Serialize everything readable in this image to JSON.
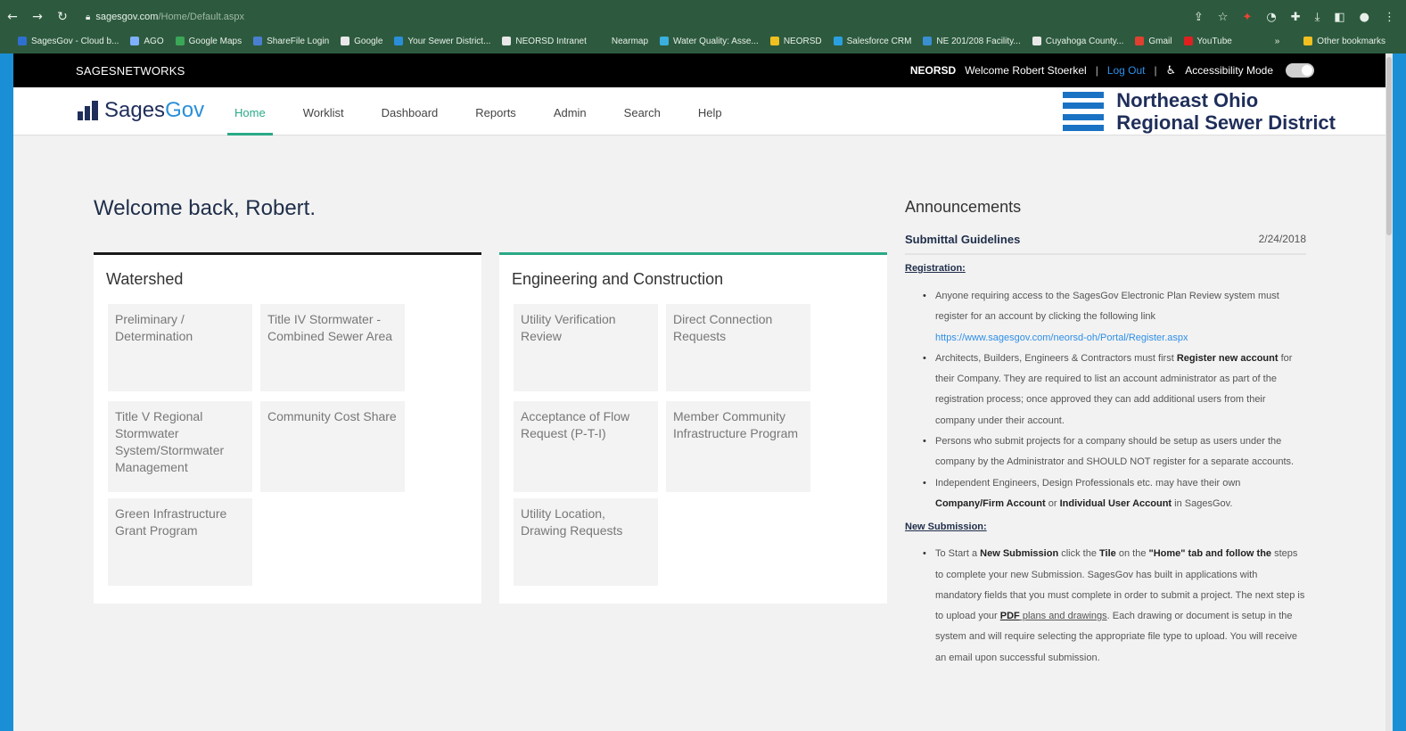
{
  "browser": {
    "url_host": "sagesgov.com",
    "url_path": "/Home/Default.aspx",
    "bookmarks": [
      {
        "label": "SagesGov - Cloud b...",
        "color": "#2f6fd0"
      },
      {
        "label": "AGO",
        "color": "#7fb0ff"
      },
      {
        "label": "Google Maps",
        "color": "#3aa757"
      },
      {
        "label": "ShareFile Login",
        "color": "#4a7fd0"
      },
      {
        "label": "Google",
        "color": "#e8e8e8"
      },
      {
        "label": "Your Sewer District...",
        "color": "#2a8fd8"
      },
      {
        "label": "NEORSD Intranet",
        "color": "#e8e8e8"
      },
      {
        "label": "Nearmap",
        "color": "#2d5a3e"
      },
      {
        "label": "Water Quality: Asse...",
        "color": "#3ab0e0"
      },
      {
        "label": "NEORSD",
        "color": "#f0c020"
      },
      {
        "label": "Salesforce CRM",
        "color": "#2aa0e0"
      },
      {
        "label": "NE 201/208 Facility...",
        "color": "#3a8fd0"
      },
      {
        "label": "Cuyahoga County...",
        "color": "#e8e8e8"
      },
      {
        "label": "Gmail",
        "color": "#e04030"
      },
      {
        "label": "YouTube",
        "color": "#e02020"
      }
    ],
    "other_bookmarks": "Other bookmarks",
    "more": "»"
  },
  "topbar": {
    "brand": "SAGESNETWORKS",
    "org": "NEORSD",
    "welcome": "Welcome Robert Stoerkel",
    "separator": "|",
    "logout": "Log Out",
    "accessibility": "Accessibility Mode"
  },
  "header": {
    "logo_main": "Sages",
    "logo_accent": "Gov",
    "nav": [
      "Home",
      "Worklist",
      "Dashboard",
      "Reports",
      "Admin",
      "Search",
      "Help"
    ],
    "district_line1": "Northeast Ohio",
    "district_line2": "Regional Sewer District"
  },
  "welcome": "Welcome back, Robert.",
  "watershed": {
    "title": "Watershed",
    "tiles": [
      "Preliminary / Determination",
      "Title IV Stormwater - Combined Sewer Area",
      "Title V Regional Stormwater System/Stormwater Management",
      "Community Cost Share",
      "Green Infrastructure Grant Program"
    ]
  },
  "engineering": {
    "title": "Engineering and Construction",
    "tiles": [
      "Utility Verification Review",
      "Direct Connection Requests",
      "Acceptance of Flow Request (P-T-I)",
      "Member Community Infrastructure Program",
      "Utility Location, Drawing Requests"
    ]
  },
  "announcements": {
    "title": "Announcements",
    "item_title": "Submittal Guidelines",
    "item_date": "2/24/2018",
    "registration_head": "Registration:",
    "reg1_a": "Anyone requiring access to the SagesGov Electronic Plan Review system must register for an account by clicking the following link ",
    "reg1_link": "https://www.sagesgov.com/neorsd-oh/Portal/Register.aspx",
    "reg2_a": "Architects, Builders, Engineers & Contractors must first ",
    "reg2_b": "Register new account",
    "reg2_c": " for their Company. They are required to list an account administrator as part of the registration process; once approved they can add additional users from their company under their account.",
    "reg3": "Persons who submit projects for a company should be setup as users under the company by the Administrator and SHOULD NOT register for a separate accounts.",
    "reg4_a": "Independent Engineers, Design Professionals etc. may have their own ",
    "reg4_b": "Company/Firm Account",
    "reg4_c": " or ",
    "reg4_d": "Individual User Account",
    "reg4_e": " in SagesGov.",
    "new_sub_head": "New Submission:",
    "ns_a": "To Start a ",
    "ns_b": "New Submission",
    "ns_c": " click the ",
    "ns_d": "Tile",
    "ns_e": " on the ",
    "ns_f": "\"Home\" tab and follow the",
    "ns_g": " steps to complete your new Submission. SagesGov has built in applications with mandatory fields that you must complete in order to submit a project.  The next step is to upload your ",
    "ns_h": "PDF",
    "ns_i": " plans and drawings",
    "ns_j": ". Each drawing or document is setup in the system and will require selecting the appropriate file type to upload. You will receive an email upon successful submission."
  }
}
